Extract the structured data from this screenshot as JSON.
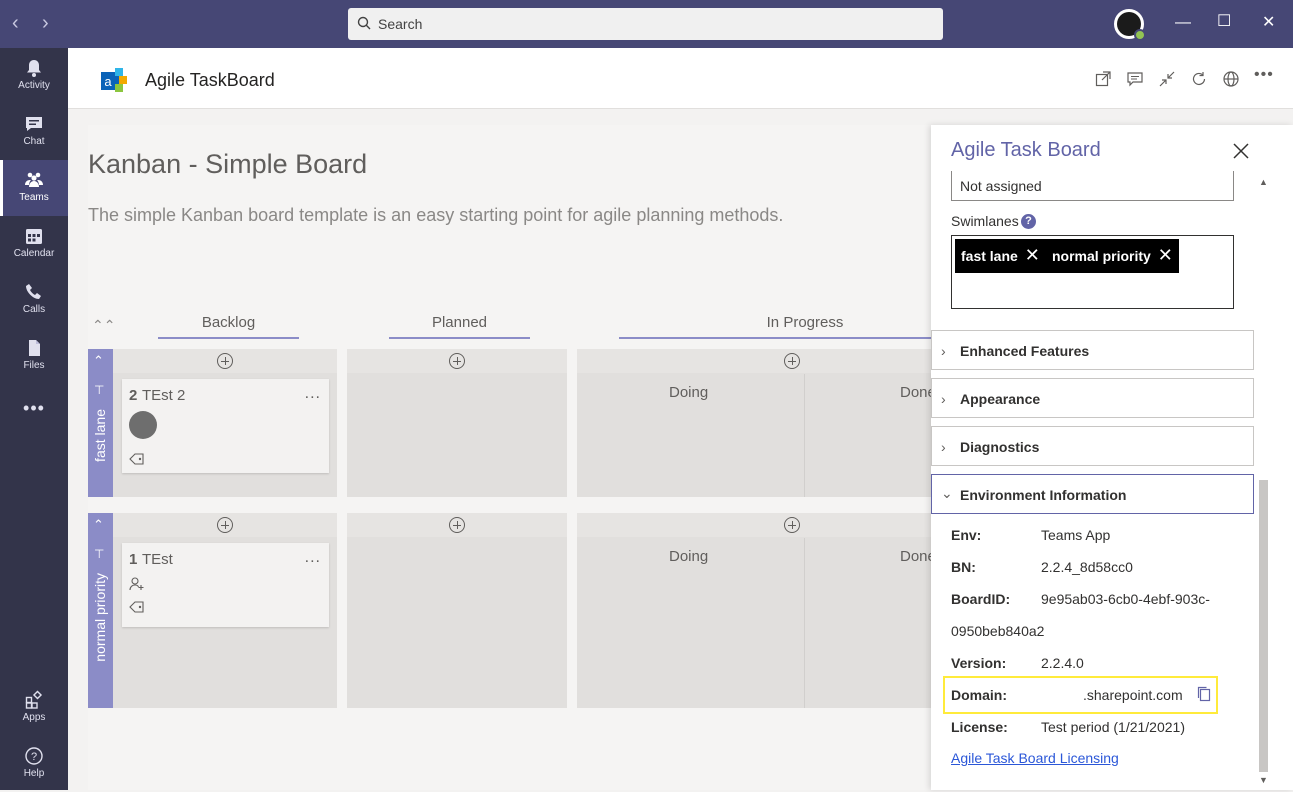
{
  "titlebar": {
    "back_icon": "chevron-left-icon",
    "forward_icon": "chevron-right-icon",
    "search_placeholder": "Search",
    "window_controls": [
      "minimize",
      "maximize",
      "close"
    ]
  },
  "rail": {
    "items": [
      {
        "label": "Activity",
        "icon": "bell-icon"
      },
      {
        "label": "Chat",
        "icon": "chat-icon"
      },
      {
        "label": "Teams",
        "icon": "teams-icon",
        "active": true
      },
      {
        "label": "Calendar",
        "icon": "calendar-icon"
      },
      {
        "label": "Calls",
        "icon": "phone-icon"
      },
      {
        "label": "Files",
        "icon": "file-icon"
      },
      {
        "label": "",
        "icon": "more-icon"
      },
      {
        "label": "Apps",
        "icon": "apps-icon"
      },
      {
        "label": "Help",
        "icon": "help-icon"
      }
    ]
  },
  "app": {
    "title": "Agile TaskBoard",
    "header_icons": [
      "popout-icon",
      "conversation-icon",
      "collapse-icon",
      "refresh-icon",
      "globe-icon",
      "more-icon"
    ]
  },
  "board": {
    "title": "Kanban - Simple Board",
    "description": "The simple Kanban board template is an easy starting point for agile planning methods.",
    "columns": [
      "Backlog",
      "Planned",
      "In Progress"
    ],
    "subcolumns": [
      "Doing",
      "Done"
    ],
    "lanes": [
      {
        "label": "fast lane",
        "card": {
          "id": "2",
          "title": "TEst 2",
          "more": "..."
        }
      },
      {
        "label": "normal priority",
        "card": {
          "id": "1",
          "title": "TEst",
          "more": "..."
        }
      }
    ]
  },
  "panel": {
    "title": "Agile Task Board",
    "assigned_value": "Not assigned",
    "swimlanes_label": "Swimlanes",
    "help_glyph": "?",
    "swimlanes": [
      "fast lane",
      "normal priority"
    ],
    "sections": [
      "Enhanced Features",
      "Appearance",
      "Diagnostics",
      "Environment Information"
    ],
    "env": {
      "env_key": "Env:",
      "env_val": "Teams App",
      "bn_key": "BN:",
      "bn_val": "2.2.4_8d58cc0",
      "board_key": "BoardID:",
      "board_val1": "9e95ab03-6cb0-4ebf-903c-",
      "board_val2": "0950beb840a2",
      "version_key": "Version:",
      "version_val": "2.2.4.0",
      "domain_key": "Domain:",
      "domain_val": ".sharepoint.com",
      "license_key": "License:",
      "license_val": "Test period (1/21/2021)"
    },
    "licensing_link": "Agile Task Board Licensing"
  },
  "colors": {
    "titlebar": "#464775",
    "rail": "#33344a",
    "accent": "#6264a7",
    "lane": "#8b8cc7",
    "highlight": "#ffeb3b"
  }
}
